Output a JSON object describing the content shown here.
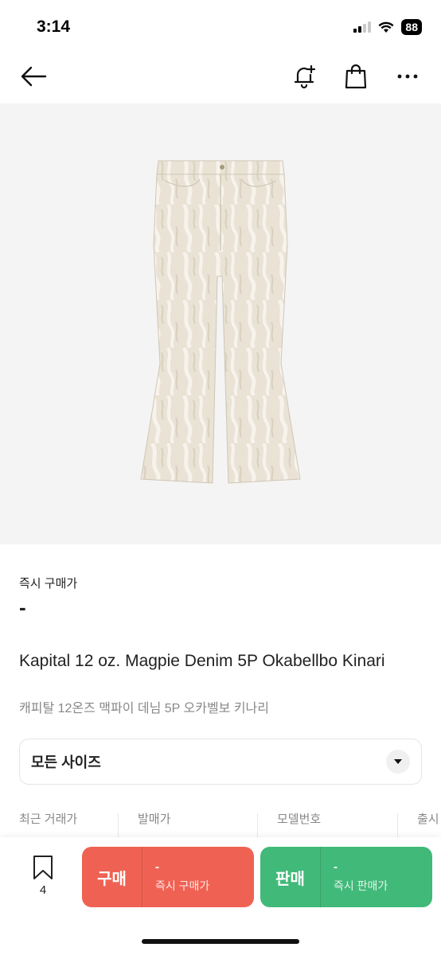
{
  "status_bar": {
    "time": "3:14",
    "battery": "88",
    "icons": [
      "signal-icon",
      "wifi-icon",
      "battery-icon"
    ]
  },
  "nav": {
    "icons": [
      "back-arrow-icon",
      "bell-plus-icon",
      "shopping-bag-icon",
      "more-dots-icon"
    ]
  },
  "product": {
    "image_subject": "Kapital denim flare jeans",
    "instant_price_label": "즉시 구매가",
    "instant_price_value": "-",
    "title_en": "Kapital 12 oz. Magpie Denim 5P Okabellbo Kinari",
    "title_ko": "캐피탈 12온즈 맥파이 데님 5P 오카벨보 키나리"
  },
  "size_select": {
    "label": "모든 사이즈",
    "icon": "chevron-down-icon"
  },
  "info": {
    "columns": [
      {
        "label": "최근 거래가",
        "value": ""
      },
      {
        "label": "발매가",
        "value": ""
      },
      {
        "label": "모델번호",
        "value": ""
      },
      {
        "label": "출시",
        "value": ""
      }
    ]
  },
  "bottom_bar": {
    "bookmark_count": "4",
    "buy": {
      "label": "구매",
      "price": "-",
      "sub_label": "즉시 구매가"
    },
    "sell": {
      "label": "판매",
      "price": "-",
      "sub_label": "즉시 판매가"
    }
  },
  "colors": {
    "buy": "#ef6253",
    "sell": "#41b979",
    "hero_bg": "#f4f4f4"
  }
}
